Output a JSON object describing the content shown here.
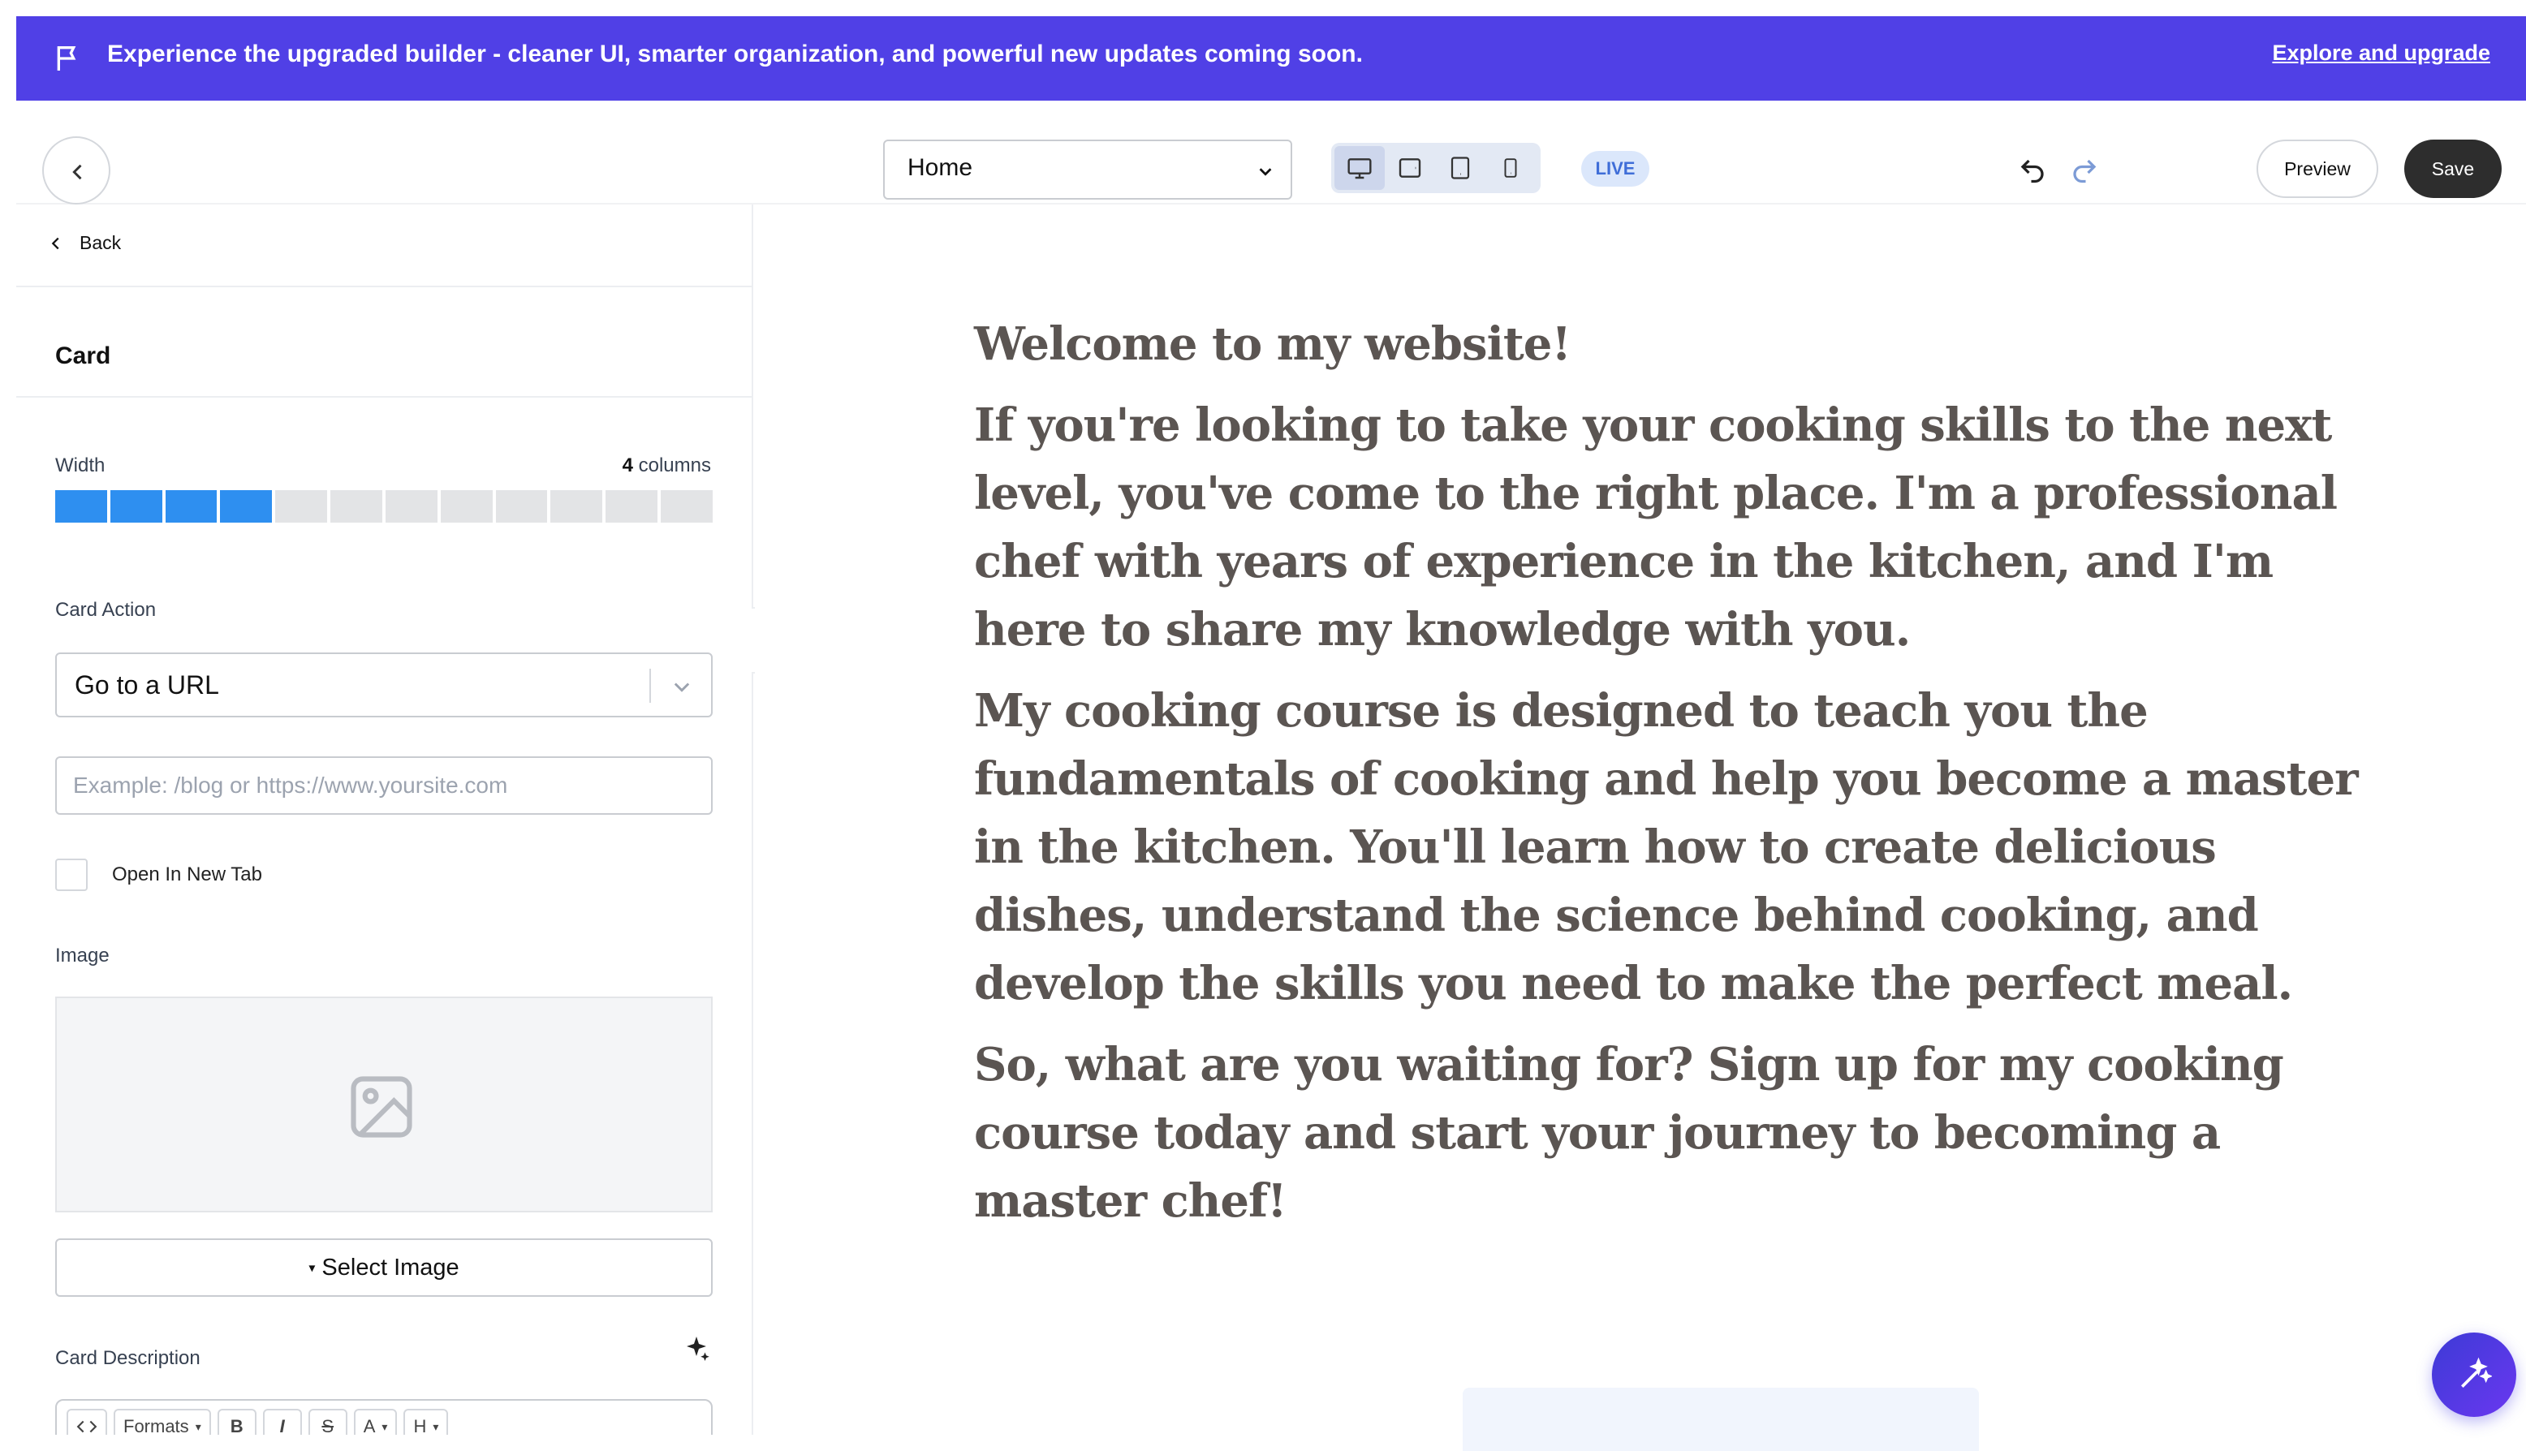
{
  "banner": {
    "message": "Experience the upgraded builder - cleaner UI, smarter organization, and powerful new updates coming soon.",
    "link": "Explore and upgrade",
    "color": "#5040e6"
  },
  "toolbar": {
    "page_select": "Home",
    "devices": [
      "desktop-icon",
      "tablet-landscape-icon",
      "tablet-portrait-icon",
      "mobile-icon"
    ],
    "active_device": "desktop",
    "status": "LIVE",
    "preview": "Preview",
    "save": "Save"
  },
  "sidebar": {
    "back": "Back",
    "title": "Card",
    "width_label": "Width",
    "width_value": "4",
    "width_unit": "columns",
    "width_total": 12,
    "card_action_label": "Card Action",
    "card_action_value": "Go to a URL",
    "url_placeholder": "Example: /blog or https://www.yoursite.com",
    "open_new_tab": "Open In New Tab",
    "image_label": "Image",
    "select_image": "Select Image",
    "card_description_label": "Card Description",
    "editor": {
      "formats": "Formats",
      "bold": "B",
      "italic": "I",
      "strike": "S",
      "font_color": "A",
      "heading": "H"
    }
  },
  "canvas": {
    "paragraphs": [
      "Welcome to my website!",
      "If you're looking to take your cooking skills to the next level, you've come to the right place. I'm a professional chef with years of experience in the kitchen, and I'm here to share my knowledge with you.",
      "My cooking course is designed to teach you the fundamentals of cooking and help you become a master in the kitchen. You'll learn how to create delicious dishes, understand the science behind cooking, and develop the skills you need to make the perfect meal.",
      "So, what are you waiting for? Sign up for my cooking course today and start your journey to becoming a master chef!"
    ]
  }
}
